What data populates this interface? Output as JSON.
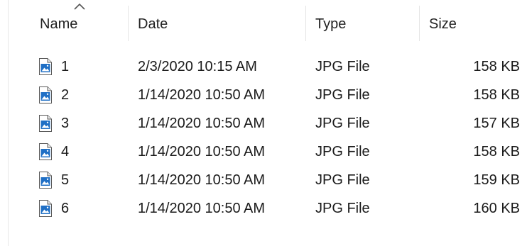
{
  "columns": {
    "name": "Name",
    "date": "Date",
    "type": "Type",
    "size": "Size"
  },
  "sort": {
    "column": "name",
    "icon": "chevron-up-icon"
  },
  "file_icon": "image-file-icon",
  "files": [
    {
      "name": "1",
      "date": "2/3/2020 10:15 AM",
      "type": "JPG File",
      "size": "158 KB"
    },
    {
      "name": "2",
      "date": "1/14/2020 10:50 AM",
      "type": "JPG File",
      "size": "158 KB"
    },
    {
      "name": "3",
      "date": "1/14/2020 10:50 AM",
      "type": "JPG File",
      "size": "157 KB"
    },
    {
      "name": "4",
      "date": "1/14/2020 10:50 AM",
      "type": "JPG File",
      "size": "158 KB"
    },
    {
      "name": "5",
      "date": "1/14/2020 10:50 AM",
      "type": "JPG File",
      "size": "159 KB"
    },
    {
      "name": "6",
      "date": "1/14/2020 10:50 AM",
      "type": "JPG File",
      "size": "160 KB"
    }
  ]
}
